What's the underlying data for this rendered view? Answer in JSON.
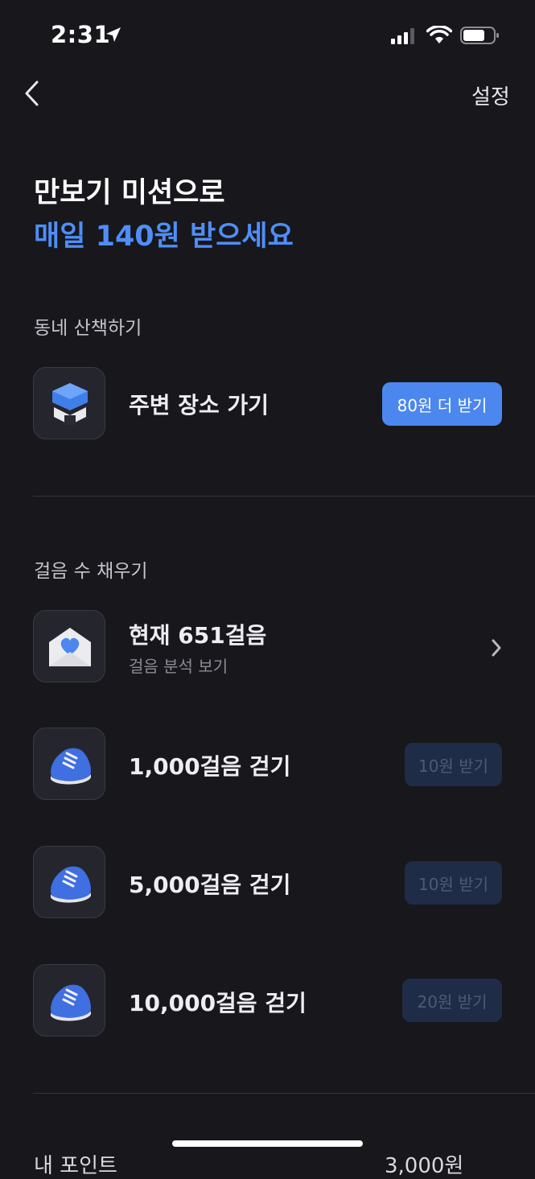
{
  "status_bar": {
    "time": "2:31"
  },
  "header": {
    "settings_label": "설정"
  },
  "hero": {
    "line1": "만보기 미션으로",
    "line2": "매일 140원 받으세요"
  },
  "walk_section": {
    "title": "동네 산책하기",
    "item": {
      "label": "주변 장소 가기",
      "button": "80원 더 받기",
      "icon": "map-pin-3d-icon"
    }
  },
  "steps_section": {
    "title": "걸음 수 채우기",
    "current": {
      "label": "현재 651걸음",
      "sub": "걸음 분석 보기",
      "icon": "heart-envelope-icon"
    },
    "missions": [
      {
        "label": "1,000걸음 걷기",
        "button": "10원 받기",
        "icon": "sneaker-icon"
      },
      {
        "label": "5,000걸음 걷기",
        "button": "10원 받기",
        "icon": "sneaker-icon"
      },
      {
        "label": "10,000걸음 걷기",
        "button": "20원 받기",
        "icon": "sneaker-icon"
      }
    ]
  },
  "footer": {
    "label": "내 포인트",
    "value": "3,000원"
  },
  "colors": {
    "accent": "#4f8ef7",
    "button": "#4b87ef",
    "disabled_button": "#1f2c47",
    "background": "#17171c"
  }
}
